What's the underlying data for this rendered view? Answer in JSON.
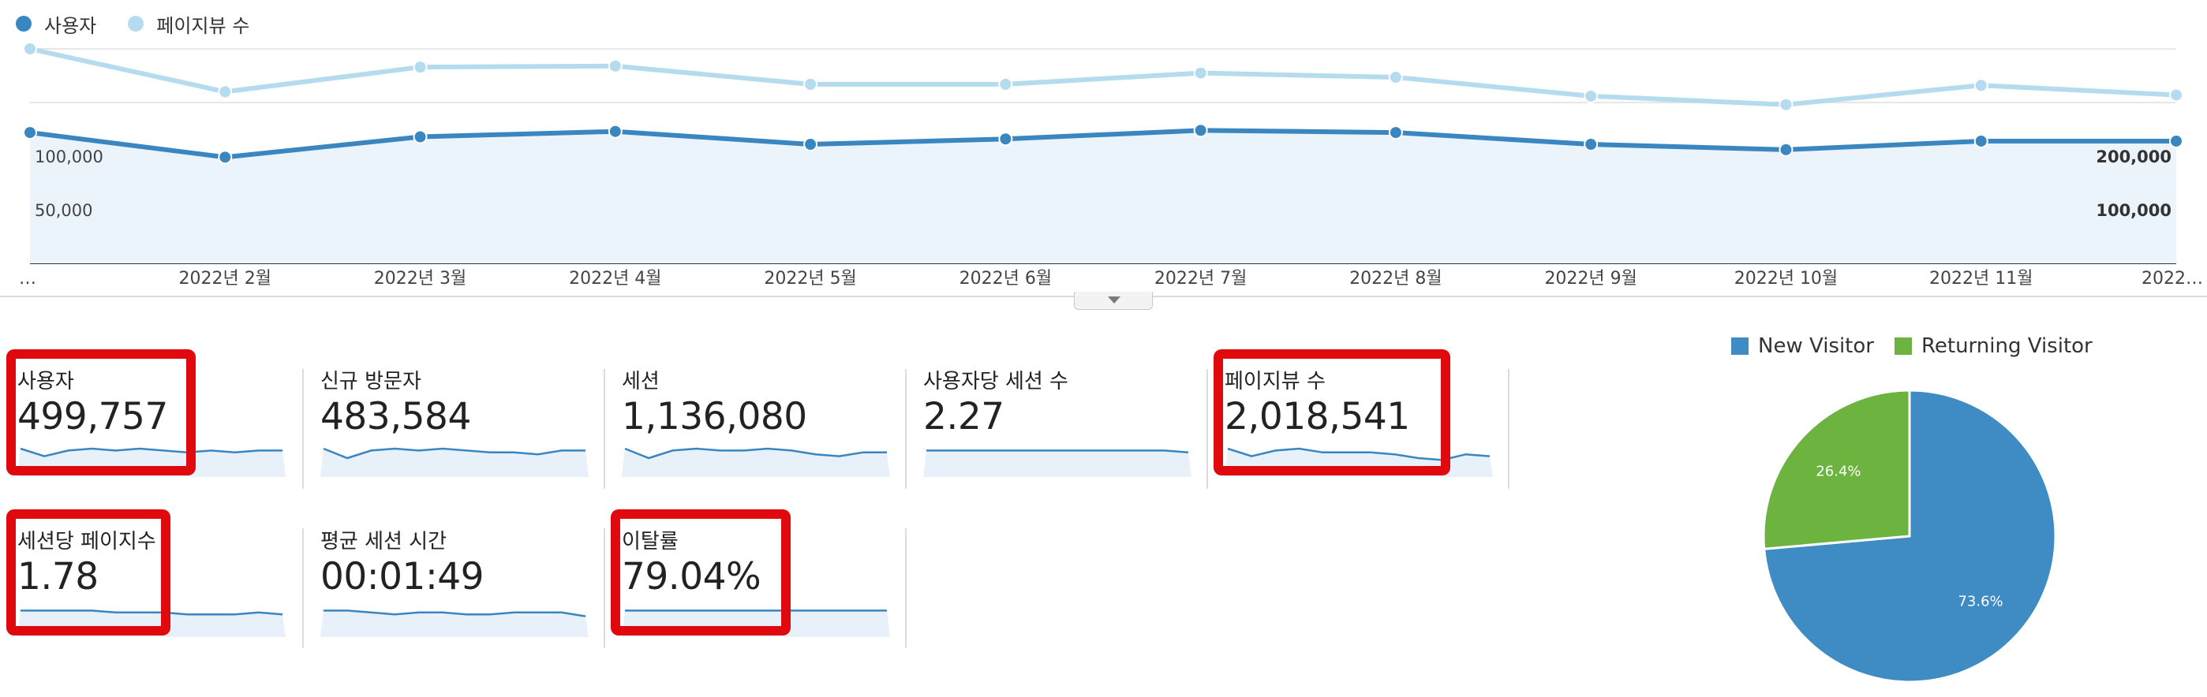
{
  "legend": {
    "items": [
      {
        "label": "사용자",
        "color": "#3a86c0"
      },
      {
        "label": "페이지뷰 수",
        "color": "#b5dbef"
      }
    ]
  },
  "chart_data": {
    "type": "line",
    "x_labels": [
      "…",
      "2022년 2월",
      "2022년 3월",
      "2022년 4월",
      "2022년 5월",
      "2022년 6월",
      "2022년 7월",
      "2022년 8월",
      "2022년 9월",
      "2022년 10월",
      "2022년 11월",
      "2022…"
    ],
    "left_axis": {
      "ticks": [
        "100,000",
        "50,000"
      ],
      "range": [
        0,
        200000
      ]
    },
    "right_axis": {
      "ticks": [
        "200,000",
        "100,000"
      ],
      "range": [
        0,
        400000
      ]
    },
    "series": [
      {
        "name": "사용자",
        "axis": "left",
        "color": "#3a86c0",
        "values": [
          122000,
          99000,
          118000,
          123000,
          111000,
          116000,
          124000,
          122000,
          111000,
          106000,
          114000,
          114000
        ]
      },
      {
        "name": "페이지뷰 수",
        "axis": "right",
        "color": "#b5dbef",
        "values": [
          400000,
          320000,
          366000,
          368000,
          334000,
          334000,
          355000,
          347000,
          312000,
          296000,
          332000,
          314000
        ]
      }
    ],
    "grid": true
  },
  "metrics": [
    {
      "label": "사용자",
      "value": "499,757",
      "highlighted": true,
      "trend": [
        10,
        6,
        9,
        10,
        9,
        10,
        9,
        8,
        9,
        8,
        9,
        9
      ]
    },
    {
      "label": "신규 방문자",
      "value": "483,584",
      "highlighted": false,
      "trend": [
        10,
        5,
        9,
        10,
        9,
        10,
        9,
        8,
        8,
        7,
        9,
        9
      ]
    },
    {
      "label": "세션",
      "value": "1,136,080",
      "highlighted": false,
      "trend": [
        10,
        5,
        9,
        10,
        9,
        9,
        10,
        9,
        7,
        6,
        8,
        8
      ]
    },
    {
      "label": "사용자당 세션 수",
      "value": "2.27",
      "highlighted": false,
      "trend": [
        9,
        9,
        9,
        9,
        9,
        9,
        9,
        9,
        9,
        9,
        9,
        8
      ]
    },
    {
      "label": "페이지뷰 수",
      "value": "2,018,541",
      "highlighted": true,
      "trend": [
        10,
        6,
        9,
        10,
        8,
        8,
        8,
        7,
        5,
        4,
        7,
        6
      ]
    },
    {
      "label": "세션당 페이지수",
      "value": "1.78",
      "highlighted": true,
      "trend": [
        9,
        9,
        9,
        9,
        8,
        8,
        8,
        7,
        7,
        7,
        8,
        7
      ]
    },
    {
      "label": "평균 세션 시간",
      "value": "00:01:49",
      "highlighted": false,
      "trend": [
        9,
        9,
        8,
        7,
        8,
        8,
        7,
        7,
        8,
        8,
        8,
        6
      ]
    },
    {
      "label": "이탈률",
      "value": "79.04%",
      "highlighted": true,
      "trend": [
        9,
        9,
        9,
        9,
        9,
        9,
        9,
        9,
        9,
        9,
        9,
        9
      ]
    }
  ],
  "pie_chart": {
    "type": "pie",
    "legend": [
      {
        "label": "New Visitor",
        "color": "#3f8bc4"
      },
      {
        "label": "Returning Visitor",
        "color": "#6db33f"
      }
    ],
    "slices": [
      {
        "name": "New Visitor",
        "value": 73.6,
        "label": "73.6%",
        "color": "#3f8bc4"
      },
      {
        "name": "Returning Visitor",
        "value": 26.4,
        "label": "26.4%",
        "color": "#6db33f"
      }
    ]
  }
}
